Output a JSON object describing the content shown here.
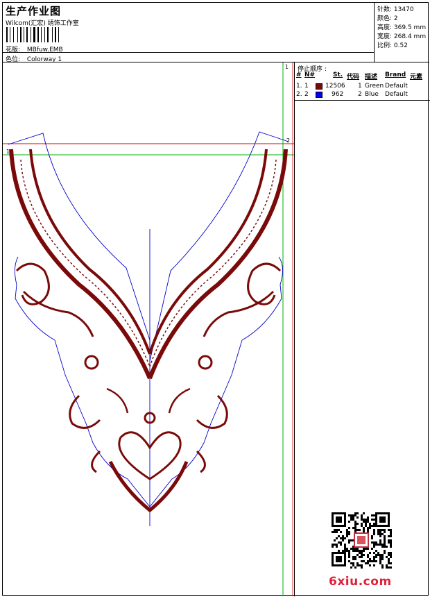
{
  "header": {
    "title": "生产作业图",
    "subtitle": "Wilcom(汇宏) 绣饰工作室",
    "design_label": "花版:",
    "design_value": "MBfuw.EMB",
    "colorway_label": "色位:",
    "colorway_value": "Colorway 1"
  },
  "stats": [
    {
      "label": "针数:",
      "value": "13470"
    },
    {
      "label": "颜色:",
      "value": "2"
    },
    {
      "label": "高度:",
      "value": "369.5 mm"
    },
    {
      "label": "宽度:",
      "value": "268.4 mm"
    },
    {
      "label": "比例:",
      "value": "0.52"
    }
  ],
  "sequence": {
    "title": "停止顺序 :",
    "columns": [
      "#",
      "N#",
      "St.",
      "代码",
      "描述",
      "Brand",
      "元素"
    ],
    "rows": [
      {
        "index": "1.",
        "n": "1",
        "swatch": "#7a0a0a",
        "stitches": "12506",
        "code": "1",
        "description": "Green",
        "brand": "Default"
      },
      {
        "index": "2.",
        "n": "2",
        "swatch": "#0000ee",
        "stitches": "962",
        "code": "2",
        "description": "Blue",
        "brand": "Default"
      }
    ]
  },
  "canvas": {
    "marker_top": "1",
    "marker_red": "2",
    "marker_green": "1"
  },
  "colors": {
    "embroidery": "#7a0a0a",
    "outline": "#0000cc",
    "guide_green": "#00b000",
    "guide_red": "#e00000"
  },
  "watermark": {
    "text": "6xiu.com"
  }
}
